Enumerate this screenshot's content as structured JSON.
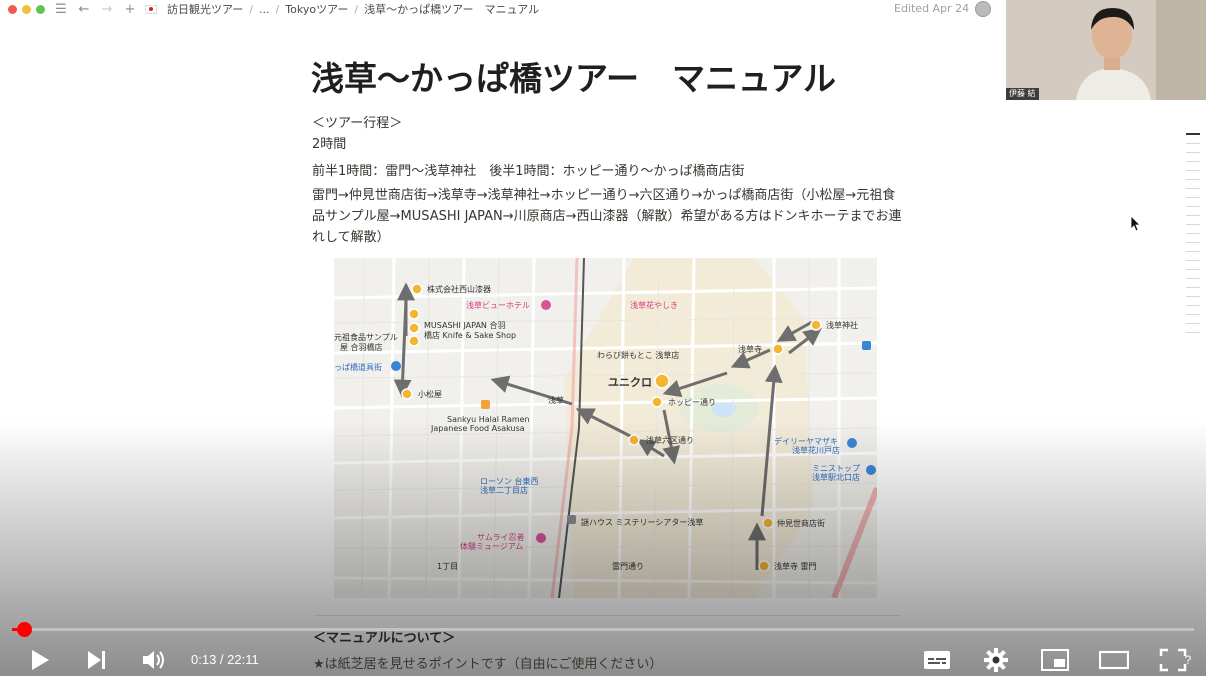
{
  "topbar": {
    "breadcrumbs": [
      "訪日観光ツアー",
      "...",
      "Tokyoツアー",
      "浅草〜かっぱ橋ツアー　マニュアル"
    ],
    "edited": "Edited Apr 24"
  },
  "page": {
    "title": "浅草〜かっぱ橋ツアー　マニュアル",
    "itinerary_heading": "＜ツアー行程＞",
    "duration": "2時間",
    "halves": "前半1時間：雷門〜浅草神社　後半1時間：ホッピー通り〜かっぱ橋商店街",
    "route": "雷門→仲見世商店街→浅草寺→浅草神社→ホッピー通り→六区通り→かっぱ橋商店街（小松屋→元祖食品サンプル屋→MUSASHI JAPAN→川原商店→西山漆器（解散）希望がある方はドンキホーテまでお連れして解散）",
    "manual_heading": "＜マニュアルについて＞",
    "manual_note": "★は紙芝居を見せるポイントです（自由にご使用ください）"
  },
  "map": {
    "labels": {
      "nishiyama": "株式会社西山漆器",
      "view_hotel": "浅草ビューホテル",
      "musashi": "MUSASHI JAPAN 合羽",
      "musashi2": "橋店 Knife & Sake Shop",
      "ganso": "元祖食品サンプル",
      "ganso2": "屋 合羽橋店",
      "kappabashi": "っぱ橋道具街",
      "komatsuya": "小松屋",
      "hanayashiki": "浅草花やしき",
      "warabi": "わらび餅もとこ 浅草店",
      "uniqlo": "ユニクロ",
      "sensoji": "浅草寺",
      "jinja": "浅草神社",
      "hoppy": "ホッピー通り",
      "asakusa": "浅草",
      "sankyu": "Sankyu Halal Ramen",
      "sankyu2": "Japanese Food Asakusa",
      "rokku": "浅草六区通り",
      "lawson": "ローソン 台東西",
      "lawson2": "浅草二丁目店",
      "daily": "デイリーヤマザキ",
      "daily2": "浅草花川戸店",
      "ministop": "ミニストップ",
      "ministop2": "浅草駅北口店",
      "nakamise": "仲見世商店街",
      "samurai": "サムライ忍者",
      "samurai2": "体験ミュージアム",
      "nazo": "謎ハウス ミステリーシアター浅草",
      "kaminarimon": "浅草寺 雷門",
      "kaminarimon_dori": "雷門通り",
      "chome1": "1丁目"
    }
  },
  "player": {
    "time": "0:13 / 22:11",
    "progress": 0.0098
  },
  "webcam": {
    "name": "伊藤 結"
  },
  "colors": {
    "progress": "#ff0000",
    "pin": "#f4b530",
    "arrow": "#6e6e6e"
  }
}
